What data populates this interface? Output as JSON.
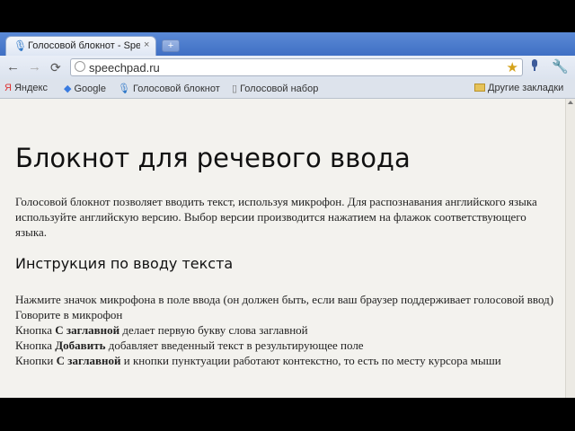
{
  "browser": {
    "tab": {
      "title": "Голосовой блокнот - Spe",
      "close": "×"
    },
    "newtab": "+",
    "toolbar": {
      "back": "←",
      "forward": "→",
      "reload": "⟳",
      "url": "speechpad.ru",
      "star": "★",
      "wrench": "🔧"
    },
    "bookmarks": {
      "yandex": "Яндекс",
      "google": "Google",
      "notepad": "Голосовой блокнот",
      "dial": "Голосовой набор",
      "other": "Другие закладки"
    },
    "icons": [
      "back-arrow-icon",
      "forward-arrow-icon",
      "reload-icon",
      "page-icon",
      "star-icon",
      "microphone-icon",
      "wrench-icon",
      "folder-icon"
    ]
  },
  "page": {
    "heading": "Блокнот для речевого ввода",
    "intro": "Голосовой блокнот позволяет вводить текст, используя микрофон. Для распознавания английского языка используйте английскую версию. Выбор версии производится нажатием на флажок соответствующего языка.",
    "subheading": "Инструкция по вводу текста",
    "instructions": {
      "line1": "Нажмите значок микрофона в поле ввода (он должен быть, если ваш браузер поддерживает голосовой ввод)",
      "line2": "Говорите в микрофон",
      "line3": {
        "prefix": "Кнопка ",
        "bold": "С заглавной",
        "rest": " делает первую букву слова заглавной"
      },
      "line4": {
        "prefix": "Кнопка ",
        "bold": "Добавить",
        "rest": " добавляет введенный текст в результирующее поле"
      },
      "line5": {
        "prefix": "Кнопки ",
        "bold": "С заглавной",
        "rest": " и кнопки пунктуации работают контекстно, то есть по месту курсора мыши"
      }
    }
  }
}
